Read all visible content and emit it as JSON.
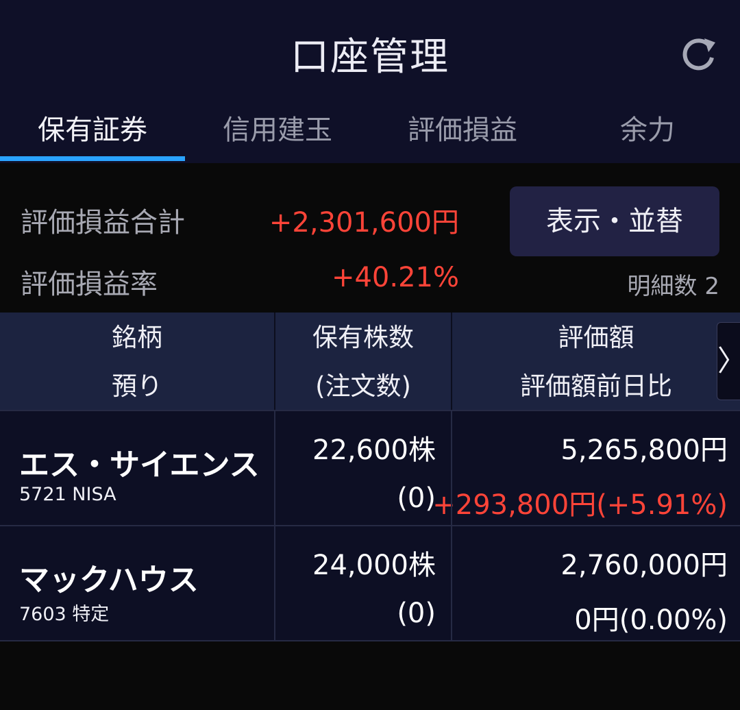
{
  "header": {
    "title": "口座管理",
    "refresh_icon": "refresh-icon"
  },
  "tabs": [
    {
      "label": "保有証券",
      "active": true
    },
    {
      "label": "信用建玉",
      "active": false
    },
    {
      "label": "評価損益",
      "active": false
    },
    {
      "label": "余力",
      "active": false
    }
  ],
  "summary": {
    "pl_total_label": "評価損益合計",
    "pl_total_value": "+2,301,600円",
    "pl_rate_label": "評価損益率",
    "pl_rate_value": "+40.21%",
    "sort_button_label": "表示・並替",
    "detail_count": "明細数 2"
  },
  "table": {
    "headers": {
      "col1_line1": "銘柄",
      "col1_line2": "預り",
      "col2_line1": "保有株数",
      "col2_line2": "(注文数)",
      "col3_line1": "評価額",
      "col3_line2": "評価額前日比"
    },
    "next_icon": "chevron-right-icon",
    "rows": [
      {
        "name": "エス・サイエンス",
        "sub": "5721 NISA",
        "shares": "22,600株",
        "orders": "(0)",
        "value": "5,265,800円",
        "change": "+293,800円(+5.91%)"
      },
      {
        "name": "マックハウス",
        "sub": "7603 特定",
        "shares": "24,000株",
        "orders": "(0)",
        "value": "2,760,000円",
        "change": "0円(0.00%)"
      }
    ]
  },
  "colors": {
    "accent": "#2aa3ff",
    "positive": "#ff4438",
    "header_bg": "#0f1028",
    "table_head_bg": "#1c2340"
  }
}
